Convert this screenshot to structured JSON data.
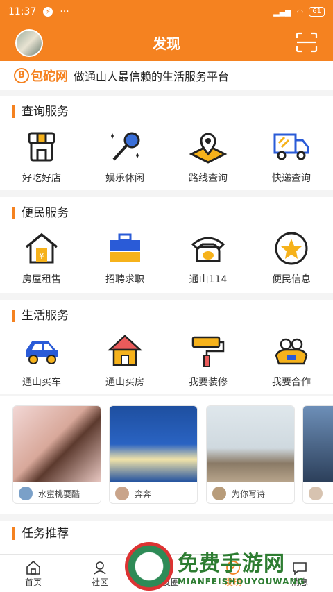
{
  "statusbar": {
    "time": "11:37",
    "battery": "61"
  },
  "header": {
    "title": "发现"
  },
  "banner": {
    "brand": "包砣网",
    "brand_letter": "B",
    "slogan": "做通山人最信赖的生活服务平台"
  },
  "query": {
    "title": "查询服务",
    "items": [
      {
        "label": "好吃好店",
        "icon": "shop-icon"
      },
      {
        "label": "娱乐休闲",
        "icon": "microphone-icon"
      },
      {
        "label": "路线查询",
        "icon": "map-pin-icon"
      },
      {
        "label": "快递查询",
        "icon": "truck-icon"
      }
    ]
  },
  "convenience": {
    "title": "便民服务",
    "items": [
      {
        "label": "房屋租售",
        "icon": "house-yen-icon"
      },
      {
        "label": "招聘求职",
        "icon": "briefcase-icon"
      },
      {
        "label": "通山114",
        "icon": "telephone-icon"
      },
      {
        "label": "便民信息",
        "icon": "star-circle-icon"
      }
    ]
  },
  "life": {
    "title": "生活服务",
    "items": [
      {
        "label": "通山买车",
        "icon": "car-icon"
      },
      {
        "label": "通山买房",
        "icon": "home-icon"
      },
      {
        "label": "我要装修",
        "icon": "paint-roller-icon"
      },
      {
        "label": "我要合作",
        "icon": "partner-icon"
      }
    ]
  },
  "cards": [
    {
      "user": "水蜜桃耍酷"
    },
    {
      "user": "奔奔"
    },
    {
      "user": "为你写诗"
    },
    {
      "user": ""
    }
  ],
  "task": {
    "title": "任务推荐"
  },
  "tabs": [
    {
      "label": "首页"
    },
    {
      "label": "社区"
    },
    {
      "label": "朋友圈"
    },
    {
      "label": "发现"
    },
    {
      "label": "消息"
    }
  ],
  "watermark": {
    "big": "免费手游网",
    "small": "MIANFEISHOUYOUWANG"
  },
  "colors": {
    "accent": "#f58220"
  }
}
